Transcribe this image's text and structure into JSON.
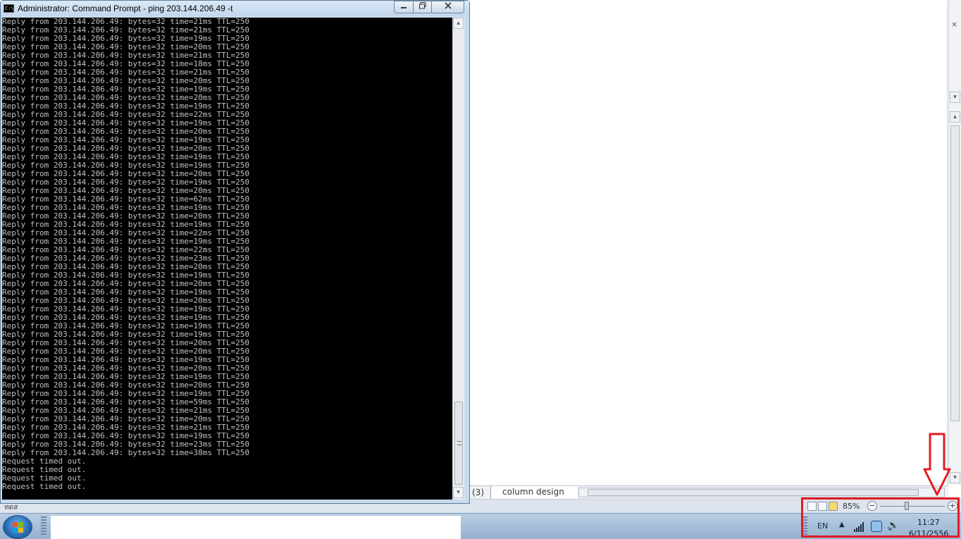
{
  "cmd": {
    "title": "Administrator: Command Prompt - ping  203.144.206.49 -t",
    "icon_text": "C:\\",
    "minimize_icon": "minimize-icon",
    "maximize_icon": "maximize-icon",
    "close_icon": "close-icon",
    "console_lines": [
      "Reply from 203.144.206.49: bytes=32 time=21ms TTL=250",
      "Reply from 203.144.206.49: bytes=32 time=21ms TTL=250",
      "Reply from 203.144.206.49: bytes=32 time=19ms TTL=250",
      "Reply from 203.144.206.49: bytes=32 time=20ms TTL=250",
      "Reply from 203.144.206.49: bytes=32 time=21ms TTL=250",
      "Reply from 203.144.206.49: bytes=32 time=18ms TTL=250",
      "Reply from 203.144.206.49: bytes=32 time=21ms TTL=250",
      "Reply from 203.144.206.49: bytes=32 time=20ms TTL=250",
      "Reply from 203.144.206.49: bytes=32 time=19ms TTL=250",
      "Reply from 203.144.206.49: bytes=32 time=20ms TTL=250",
      "Reply from 203.144.206.49: bytes=32 time=19ms TTL=250",
      "Reply from 203.144.206.49: bytes=32 time=22ms TTL=250",
      "Reply from 203.144.206.49: bytes=32 time=19ms TTL=250",
      "Reply from 203.144.206.49: bytes=32 time=20ms TTL=250",
      "Reply from 203.144.206.49: bytes=32 time=19ms TTL=250",
      "Reply from 203.144.206.49: bytes=32 time=20ms TTL=250",
      "Reply from 203.144.206.49: bytes=32 time=19ms TTL=250",
      "Reply from 203.144.206.49: bytes=32 time=19ms TTL=250",
      "Reply from 203.144.206.49: bytes=32 time=20ms TTL=250",
      "Reply from 203.144.206.49: bytes=32 time=19ms TTL=250",
      "Reply from 203.144.206.49: bytes=32 time=20ms TTL=250",
      "Reply from 203.144.206.49: bytes=32 time=62ms TTL=250",
      "Reply from 203.144.206.49: bytes=32 time=19ms TTL=250",
      "Reply from 203.144.206.49: bytes=32 time=20ms TTL=250",
      "Reply from 203.144.206.49: bytes=32 time=19ms TTL=250",
      "Reply from 203.144.206.49: bytes=32 time=22ms TTL=250",
      "Reply from 203.144.206.49: bytes=32 time=19ms TTL=250",
      "Reply from 203.144.206.49: bytes=32 time=22ms TTL=250",
      "Reply from 203.144.206.49: bytes=32 time=23ms TTL=250",
      "Reply from 203.144.206.49: bytes=32 time=20ms TTL=250",
      "Reply from 203.144.206.49: bytes=32 time=19ms TTL=250",
      "Reply from 203.144.206.49: bytes=32 time=20ms TTL=250",
      "Reply from 203.144.206.49: bytes=32 time=19ms TTL=250",
      "Reply from 203.144.206.49: bytes=32 time=20ms TTL=250",
      "Reply from 203.144.206.49: bytes=32 time=19ms TTL=250",
      "Reply from 203.144.206.49: bytes=32 time=19ms TTL=250",
      "Reply from 203.144.206.49: bytes=32 time=19ms TTL=250",
      "Reply from 203.144.206.49: bytes=32 time=19ms TTL=250",
      "Reply from 203.144.206.49: bytes=32 time=20ms TTL=250",
      "Reply from 203.144.206.49: bytes=32 time=20ms TTL=250",
      "Reply from 203.144.206.49: bytes=32 time=19ms TTL=250",
      "Reply from 203.144.206.49: bytes=32 time=20ms TTL=250",
      "Reply from 203.144.206.49: bytes=32 time=19ms TTL=250",
      "Reply from 203.144.206.49: bytes=32 time=20ms TTL=250",
      "Reply from 203.144.206.49: bytes=32 time=19ms TTL=250",
      "Reply from 203.144.206.49: bytes=32 time=59ms TTL=250",
      "Reply from 203.144.206.49: bytes=32 time=21ms TTL=250",
      "Reply from 203.144.206.49: bytes=32 time=20ms TTL=250",
      "Reply from 203.144.206.49: bytes=32 time=21ms TTL=250",
      "Reply from 203.144.206.49: bytes=32 time=19ms TTL=250",
      "Reply from 203.144.206.49: bytes=32 time=23ms TTL=250",
      "Reply from 203.144.206.49: bytes=32 time=38ms TTL=250",
      "Request timed out.",
      "Request timed out.",
      "Request timed out.",
      "Request timed out."
    ]
  },
  "taskbar_strip": {
    "text": "ทดส"
  },
  "sheet": {
    "tab_index": "(3)",
    "tab_name": "column design",
    "zoom": "85%",
    "zoom_minus": "−",
    "zoom_plus": "+",
    "close_label": "×"
  },
  "tray": {
    "language": "EN",
    "time": "11:27",
    "date": "6/11/2556",
    "show_hidden_icon": "chevron-up-icon",
    "signal_icon": "signal-bars-icon",
    "network_icon": "network-icon",
    "volume_icon": "speaker-icon"
  },
  "colors": {
    "console_bg": "#000000",
    "console_text": "#c0c0c0",
    "highlight": "#e31b23"
  }
}
